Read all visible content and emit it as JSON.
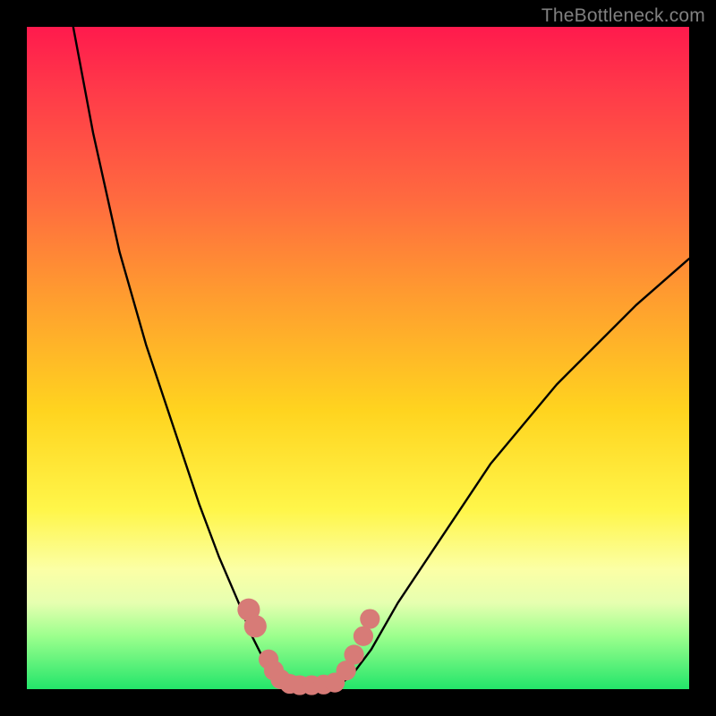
{
  "watermark": "TheBottleneck.com",
  "chart_data": {
    "type": "line",
    "title": "",
    "xlabel": "",
    "ylabel": "",
    "xlim": [
      0,
      100
    ],
    "ylim": [
      0,
      100
    ],
    "series": [
      {
        "name": "left-curve",
        "x": [
          7,
          10,
          14,
          18,
          22,
          26,
          29,
          32,
          34,
          36,
          37.5,
          38.5
        ],
        "y": [
          100,
          84,
          66,
          52,
          40,
          28,
          20,
          13,
          8,
          4,
          1.5,
          0.5
        ]
      },
      {
        "name": "valley-floor",
        "x": [
          38.5,
          40,
          42,
          44,
          46,
          47
        ],
        "y": [
          0.5,
          0.2,
          0.2,
          0.2,
          0.3,
          0.6
        ]
      },
      {
        "name": "right-curve",
        "x": [
          47,
          49,
          52,
          56,
          62,
          70,
          80,
          92,
          100
        ],
        "y": [
          0.6,
          2,
          6,
          13,
          22,
          34,
          46,
          58,
          65
        ]
      }
    ],
    "markers": {
      "name": "valley-dots",
      "color": "#d77b77",
      "points": [
        {
          "x": 33.5,
          "y": 12,
          "r": 1.7
        },
        {
          "x": 34.5,
          "y": 9.5,
          "r": 1.7
        },
        {
          "x": 36.5,
          "y": 4.5,
          "r": 1.5
        },
        {
          "x": 37.3,
          "y": 2.8,
          "r": 1.5
        },
        {
          "x": 38.3,
          "y": 1.5,
          "r": 1.5
        },
        {
          "x": 39.7,
          "y": 0.8,
          "r": 1.5
        },
        {
          "x": 41.2,
          "y": 0.6,
          "r": 1.5
        },
        {
          "x": 43.0,
          "y": 0.6,
          "r": 1.5
        },
        {
          "x": 44.8,
          "y": 0.7,
          "r": 1.5
        },
        {
          "x": 46.5,
          "y": 1.0,
          "r": 1.5
        },
        {
          "x": 48.2,
          "y": 2.8,
          "r": 1.5
        },
        {
          "x": 49.4,
          "y": 5.2,
          "r": 1.5
        },
        {
          "x": 50.8,
          "y": 8.0,
          "r": 1.5
        },
        {
          "x": 51.8,
          "y": 10.6,
          "r": 1.5
        }
      ]
    },
    "background_gradient": [
      "#ff1a4d",
      "#ffd41f",
      "#23e56a"
    ]
  }
}
